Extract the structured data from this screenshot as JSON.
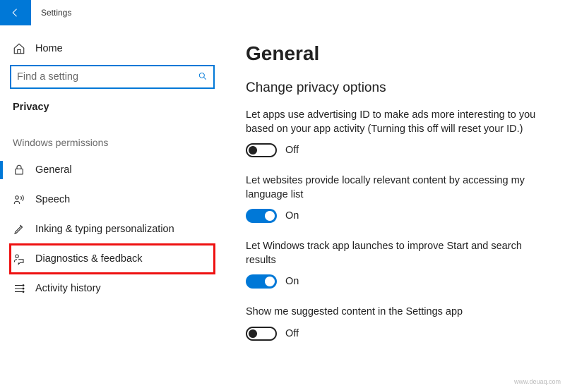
{
  "app_title": "Settings",
  "home_label": "Home",
  "search": {
    "placeholder": "Find a setting"
  },
  "sidebar": {
    "section": "Privacy",
    "group": "Windows permissions",
    "items": [
      {
        "label": "General"
      },
      {
        "label": "Speech"
      },
      {
        "label": "Inking & typing personalization"
      },
      {
        "label": "Diagnostics & feedback"
      },
      {
        "label": "Activity history"
      }
    ]
  },
  "content": {
    "title": "General",
    "subtitle": "Change privacy options",
    "options": [
      {
        "text": "Let apps use advertising ID to make ads more interesting to you based on your app activity (Turning this off will reset your ID.)",
        "state": "Off"
      },
      {
        "text": "Let websites provide locally relevant content by accessing my language list",
        "state": "On"
      },
      {
        "text": "Let Windows track app launches to improve Start and search results",
        "state": "On"
      },
      {
        "text": "Show me suggested content in the Settings app",
        "state": "Off"
      }
    ]
  },
  "watermark": "www.deuaq.com"
}
